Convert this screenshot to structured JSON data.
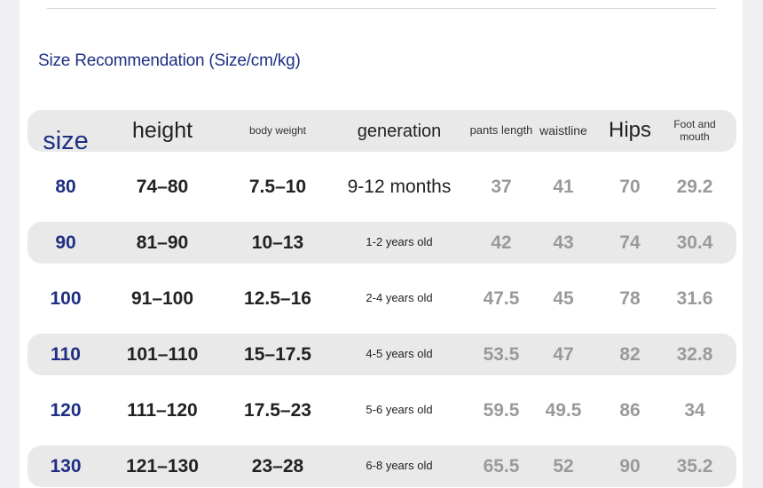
{
  "title": "Size Recommendation (Size/cm/kg)",
  "columns": [
    "size",
    "height",
    "body weight",
    "generation",
    "pants length",
    "waistline",
    "Hips",
    "Foot and mouth"
  ],
  "rows": [
    [
      "80",
      "74–80",
      "7.5–10",
      "9-12 months",
      "37",
      "41",
      "70",
      "29.2"
    ],
    [
      "90",
      "81–90",
      "10–13",
      "1-2 years old",
      "42",
      "43",
      "74",
      "30.4"
    ],
    [
      "100",
      "91–100",
      "12.5–16",
      "2-4 years old",
      "47.5",
      "45",
      "78",
      "31.6"
    ],
    [
      "110",
      "101–110",
      "15–17.5",
      "4-5 years old",
      "53.5",
      "47",
      "82",
      "32.8"
    ],
    [
      "120",
      "111–120",
      "17.5–23",
      "5-6 years old",
      "59.5",
      "49.5",
      "86",
      "34"
    ],
    [
      "130",
      "121–130",
      "23–28",
      "6-8 years old",
      "65.5",
      "52",
      "90",
      "35.2"
    ]
  ],
  "colors": {
    "accent": "#1f2f82",
    "muted_value": "#9a9a9a",
    "row_shade": "#e9e9e9"
  }
}
